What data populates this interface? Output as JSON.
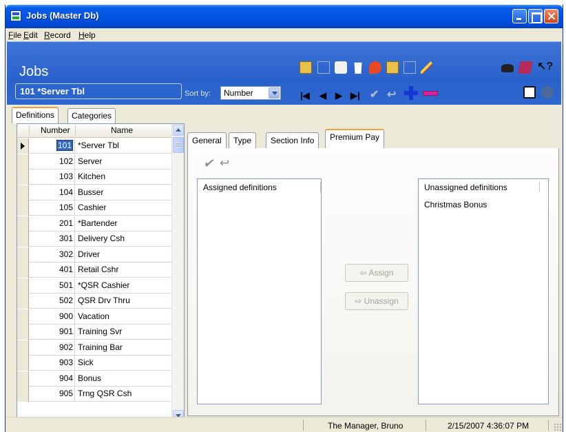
{
  "window": {
    "title": "Jobs (Master Db)"
  },
  "menu": [
    "File",
    "Edit",
    "Record",
    "Help"
  ],
  "header": {
    "title": "Jobs",
    "current_record": "101 *Server Tbl",
    "sort_label": "Sort by:",
    "sort_value": "Number"
  },
  "left_tabs": [
    "Definitions",
    "Categories"
  ],
  "grid": {
    "columns": [
      "Number",
      "Name"
    ],
    "rows": [
      {
        "number": "101",
        "name": "*Server Tbl"
      },
      {
        "number": "102",
        "name": "Server"
      },
      {
        "number": "103",
        "name": "Kitchen"
      },
      {
        "number": "104",
        "name": "Busser"
      },
      {
        "number": "105",
        "name": "Cashier"
      },
      {
        "number": "201",
        "name": "*Bartender"
      },
      {
        "number": "301",
        "name": "Delivery Csh"
      },
      {
        "number": "302",
        "name": "Driver"
      },
      {
        "number": "401",
        "name": "Retail Cshr"
      },
      {
        "number": "501",
        "name": "*QSR Cashier"
      },
      {
        "number": "502",
        "name": "QSR Drv Thru"
      },
      {
        "number": "900",
        "name": "Vacation"
      },
      {
        "number": "901",
        "name": "Training Svr"
      },
      {
        "number": "902",
        "name": "Training Bar"
      },
      {
        "number": "903",
        "name": "Sick"
      },
      {
        "number": "904",
        "name": "Bonus"
      },
      {
        "number": "905",
        "name": "Trng QSR Csh"
      }
    ]
  },
  "detail_tabs": [
    "General",
    "Type",
    "Section Info",
    "Premium Pay"
  ],
  "premium_pay": {
    "assigned_header": "Assigned definitions",
    "assigned_items": [],
    "unassigned_header": "Unassigned definitions",
    "unassigned_items": [
      "Christmas Bonus"
    ],
    "assign_button": "Assign",
    "unassign_button": "Unassign"
  },
  "status": {
    "user": "The Manager, Bruno",
    "datetime": "2/15/2007 4:36:07 PM"
  },
  "colors": {
    "title_bar": "#0055e5",
    "header_band": "#2a62cc",
    "active_tab_accent": "#e7a33c",
    "selection": "#316ac5",
    "add_icon": "#1337d6",
    "delete_icon": "#d8229c"
  }
}
